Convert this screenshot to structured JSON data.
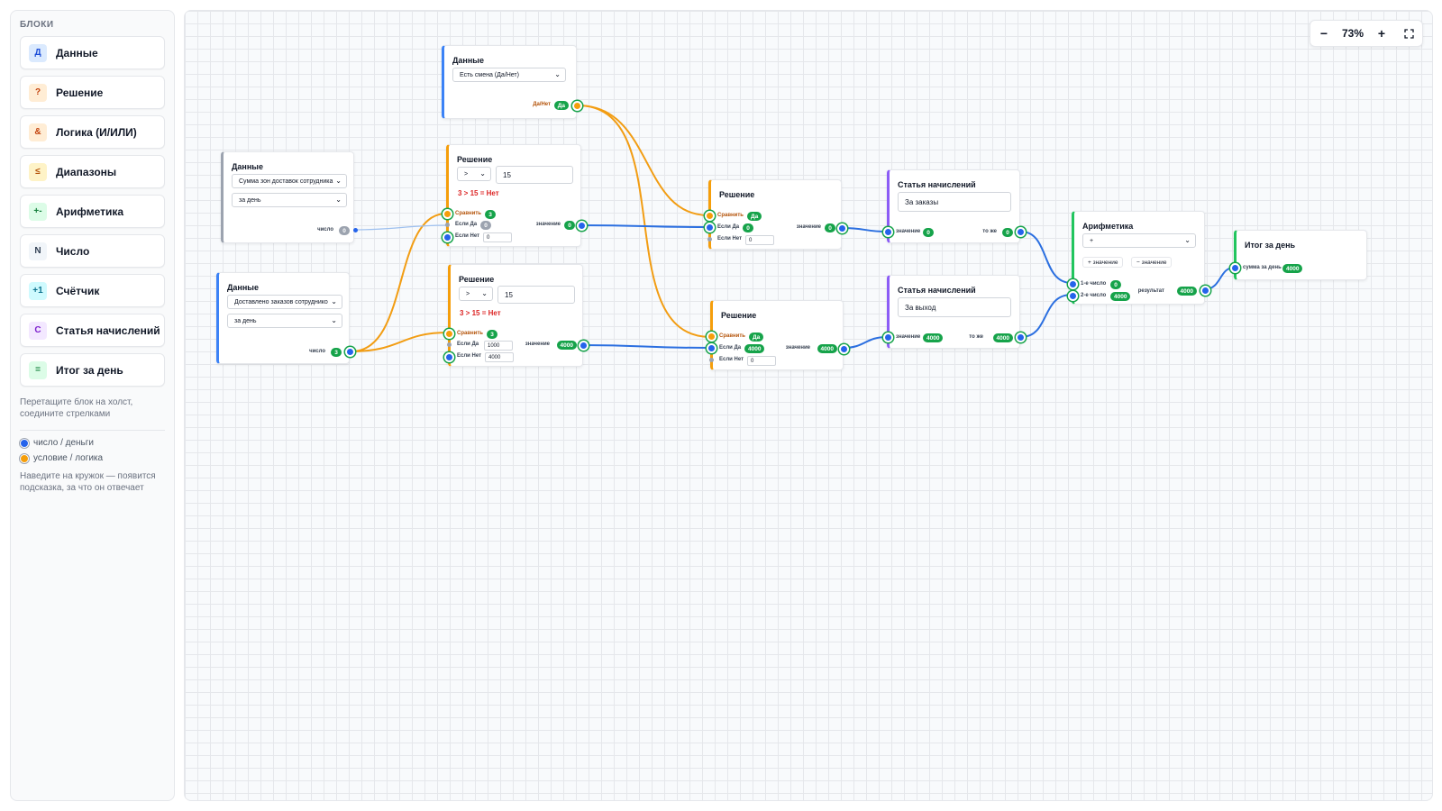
{
  "sidebar": {
    "title": "БЛОКИ",
    "items": [
      {
        "badge": "Д",
        "label": "Данные",
        "bg": "#dbeafe",
        "fg": "#1d4ed8"
      },
      {
        "badge": "?",
        "label": "Решение",
        "bg": "#ffedd5",
        "fg": "#c2410c"
      },
      {
        "badge": "&",
        "label": "Логика (И/ИЛИ)",
        "bg": "#ffedd5",
        "fg": "#c2410c"
      },
      {
        "badge": "≤",
        "label": "Диапазоны",
        "bg": "#fef3c7",
        "fg": "#b45309"
      },
      {
        "badge": "+-",
        "label": "Арифметика",
        "bg": "#dcfce7",
        "fg": "#15803d"
      },
      {
        "badge": "N",
        "label": "Число",
        "bg": "#f1f5f9",
        "fg": "#334155"
      },
      {
        "badge": "+1",
        "label": "Счётчик",
        "bg": "#cffafe",
        "fg": "#0e7490"
      },
      {
        "badge": "С",
        "label": "Статья начислений",
        "bg": "#f3e8ff",
        "fg": "#7e22ce"
      },
      {
        "badge": "=",
        "label": "Итог за день",
        "bg": "#dcfce7",
        "fg": "#15803d"
      }
    ],
    "hint": "Перетащите блок на холст, соедините стрелками",
    "legend": [
      {
        "label": "число / деньги",
        "color": "#2563eb"
      },
      {
        "label": "условие / логика",
        "color": "#f59e0b"
      }
    ],
    "hint2": "Наведите на кружок — появится подсказка, за что он отвечает"
  },
  "zoom": {
    "minus": "−",
    "value": "73%",
    "plus": "+",
    "fit_icon": "fullscreen-icon"
  },
  "colors": {
    "data": "#3b82f6",
    "decision": "#f59e0b",
    "charge": "#8b5cf6",
    "arith": "#22c55e",
    "total": "#22c55e",
    "wire_blue": "#2b6fe0",
    "wire_orange": "#f29d13"
  },
  "nodes": {
    "data_shift": {
      "title": "Данные",
      "select1": "Есть смена (Да/Нет)",
      "out_label": "Да/Нет",
      "out_value": "Да"
    },
    "data_zones": {
      "title": "Данные",
      "select1": "Сумма зон доставок сотрудника",
      "select2": "за день",
      "out_label": "число",
      "out_value": "0"
    },
    "data_orders": {
      "title": "Данные",
      "select1": "Доставлено заказов сотруднико",
      "select2": "за день",
      "out_label": "число",
      "out_value": "3"
    },
    "dec1": {
      "title": "Решение",
      "op": ">",
      "threshold": "15",
      "result": "3 > 15 = Нет",
      "cmp_label": "Сравнить",
      "cmp_value": "3",
      "yes_label": "Если Да",
      "yes_value": "0",
      "no_label": "Если Нет",
      "no_value": "0",
      "out_label": "значение",
      "out_value": "0"
    },
    "dec2": {
      "title": "Решение",
      "op": ">",
      "threshold": "15",
      "result": "3 > 15 = Нет",
      "cmp_label": "Сравнить",
      "cmp_value": "3",
      "yes_label": "Если Да",
      "yes_value": "1000",
      "no_label": "Если Нет",
      "no_value": "4000",
      "out_label": "значение",
      "out_value": "4000"
    },
    "dec3": {
      "title": "Решение",
      "cmp_label": "Сравнить",
      "cmp_value": "Да",
      "yes_label": "Если Да",
      "yes_value": "0",
      "no_label": "Если Нет",
      "no_value": "0",
      "out_label": "значение",
      "out_value": "0"
    },
    "dec4": {
      "title": "Решение",
      "cmp_label": "Сравнить",
      "cmp_value": "Да",
      "yes_label": "Если Да",
      "yes_value": "4000",
      "no_label": "Если Нет",
      "no_value": "0",
      "out_label": "значение",
      "out_value": "4000"
    },
    "charge1": {
      "title": "Статья начислений",
      "name": "За заказы",
      "in_label": "значение",
      "in_value": "0",
      "out_label": "то же",
      "out_value": "0"
    },
    "charge2": {
      "title": "Статья начислений",
      "name": "За выход",
      "in_label": "значение",
      "in_value": "4000",
      "out_label": "то же",
      "out_value": "4000"
    },
    "arith": {
      "title": "Арифметика",
      "op": "+",
      "add_btn": "+ значение",
      "remove_btn": "− значение",
      "in1_label": "1-е число",
      "in1_value": "0",
      "in2_label": "2-е число",
      "in2_value": "4000",
      "out_label": "результат",
      "out_value": "4000"
    },
    "total": {
      "title": "Итог за день",
      "in_label": "сумма за день",
      "in_value": "4000"
    }
  }
}
